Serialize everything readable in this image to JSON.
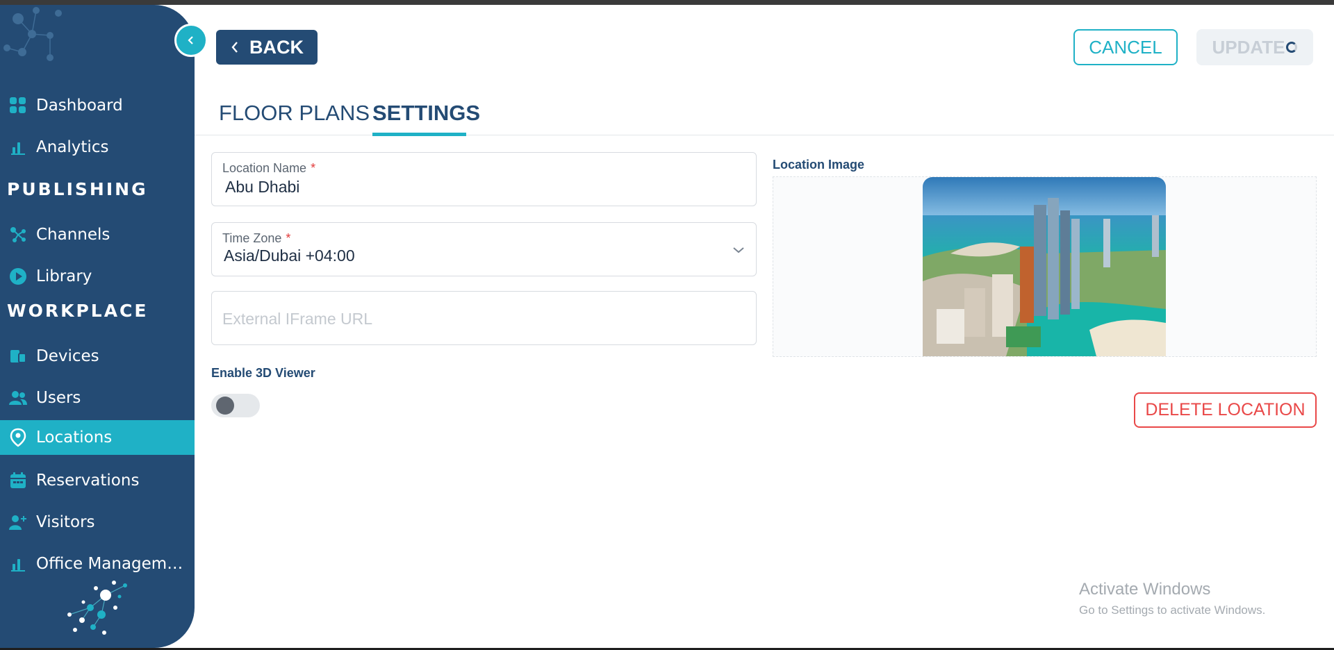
{
  "header": {
    "back_label": "BACK",
    "cancel_label": "CANCEL",
    "update_label": "UPDATE"
  },
  "tabs": [
    {
      "label": "FLOOR PLANS",
      "active": false
    },
    {
      "label": "SETTINGS",
      "active": true
    }
  ],
  "sidebar": {
    "items": [
      {
        "label": "Dashboard",
        "icon": "dashboard-grid-icon"
      },
      {
        "label": "Analytics",
        "icon": "bar-chart-icon"
      },
      {
        "label": "Channels",
        "icon": "network-icon"
      },
      {
        "label": "Library",
        "icon": "play-circle-icon"
      },
      {
        "label": "Devices",
        "icon": "devices-icon"
      },
      {
        "label": "Users",
        "icon": "users-icon"
      },
      {
        "label": "Locations",
        "icon": "map-pin-icon",
        "active": true
      },
      {
        "label": "Reservations",
        "icon": "calendar-icon"
      },
      {
        "label": "Visitors",
        "icon": "user-plus-icon"
      },
      {
        "label": "Office Management",
        "icon": "bar-chart-icon"
      }
    ],
    "sections": [
      "PUBLISHING",
      "WORKPLACE"
    ]
  },
  "form": {
    "location_name": {
      "label": "Location Name",
      "required_mark": "*",
      "value": "Abu Dhabi"
    },
    "time_zone": {
      "label": "Time Zone",
      "required_mark": "*",
      "value": "Asia/Dubai +04:00"
    },
    "iframe_url": {
      "placeholder": "External IFrame URL"
    },
    "enable_3d": {
      "label": "Enable 3D Viewer",
      "enabled": false
    },
    "image": {
      "label": "Location Image"
    },
    "delete_label": "DELETE LOCATION"
  },
  "watermark": {
    "title": "Activate Windows",
    "subtitle": "Go to Settings to activate Windows."
  },
  "colors": {
    "sidebar": "#244b74",
    "accent": "#1fb1c6",
    "danger": "#e94848"
  }
}
